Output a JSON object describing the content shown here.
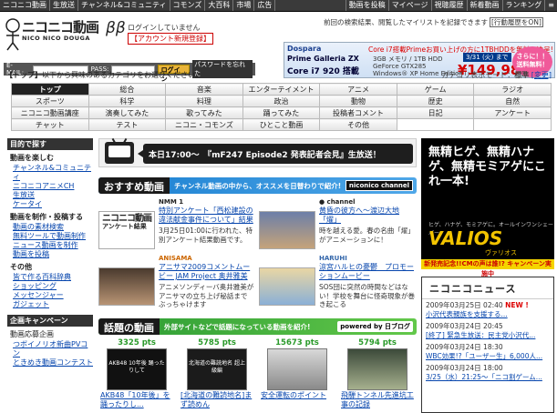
{
  "topnav": {
    "left": [
      "ニコニコ動画",
      "生放送",
      "チャンネル&コミュニティ",
      "コモンズ",
      "大百科",
      "市場",
      "広告"
    ],
    "right": [
      "動画を投稿",
      "マイページ",
      "視聴履歴",
      "新着動画",
      "ランキング",
      "≡"
    ]
  },
  "header": {
    "logo_text": "ニコニコ動画",
    "logo_sub": "NICO NICO DOUGA",
    "logo_version": "ββ",
    "login_message": "ログインしていません",
    "signup_link": "【アカウント新規登録】",
    "notice": "前回の検索結果、閲覧したマイリストを記録できます",
    "notice_link": "[行動履歴をON]"
  },
  "login": {
    "email_label": "E-MAIL:",
    "pass_label": "PASS:",
    "login_button": "ログイン",
    "forgot_button": "パスワードを忘れた"
  },
  "banner": {
    "brand": "Dospara",
    "headline": "Core i7搭載Primeお買い上げの方に1TBHDDを無料で進呈!",
    "product": "Prime Galleria ZX",
    "cpu": "Core i7 920 搭載",
    "spec1": "3GB メモリ / 1TB HDD",
    "spec2": "GeForce GTX285",
    "spec3": "Windows® XP Home Edition",
    "date": "3/31 (火) まで",
    "price": "¥149,980",
    "badge": "さらに！！ 送料無料！"
  },
  "category": {
    "breadcrumb": "【トップ】",
    "instruction": "以下から興味のあるカテゴリをお選びください。",
    "mode_label": "カテゴリ表示モード：",
    "mode_value": "標準",
    "mode_change": "[変更]",
    "rows": [
      [
        "トップ",
        "総合",
        "音楽",
        "エンターテイメント",
        "アニメ",
        "ゲーム",
        "ラジオ"
      ],
      [
        "スポーツ",
        "科学",
        "料理",
        "政治",
        "動物",
        "歴史",
        "自然"
      ],
      [
        "ニコニコ動画講座",
        "演奏してみた",
        "歌ってみた",
        "踊ってみた",
        "投稿者コメント",
        "日記",
        "アンケート"
      ],
      [
        "チャット",
        "テスト",
        "ニコニ・コモンズ",
        "ひとこと動画",
        "その他",
        "",
        ""
      ]
    ]
  },
  "sidebar": {
    "head": "目的で探す",
    "sections": [
      {
        "title": "動画を楽しむ",
        "items": [
          "チャンネル&コミュニティ",
          "ニコニコアニメCH",
          "生放送",
          "ケータイ"
        ]
      },
      {
        "title": "動画を制作・投稿する",
        "items": [
          "動画の素材検索",
          "無料ツールで動画制作",
          "ニュース動画を制作",
          "動画を投稿"
        ]
      },
      {
        "title": "その他",
        "items": [
          "皆で作る百科辞典",
          "ショッピング",
          "メッセンジャー",
          "ガジェット"
        ]
      }
    ],
    "campaign_head": "企画キャンペーン",
    "campaign_items": [
      "動画応募企画",
      "つボイノリオ新曲PVコン",
      "ときめき動画コンテスト"
    ]
  },
  "main": {
    "live_notice": "本日17:00～　『mF247 Episode2 発表記者会見』生放送！",
    "recommend": {
      "title": "おすすめ動画",
      "subtitle": "チャンネル動画の中から、オススメを日替わりで紹介!",
      "tag": "niconico channel",
      "articles": [
        {
          "source": "NMM 1",
          "title": "特別アンケート「西松建設の違法献金事件について」結果",
          "desc": "3月25日01:00に行われた、特別アンケート結果動画です。",
          "thumb_text": "アンケート結果"
        },
        {
          "source": "● channel",
          "title": "黄昏の彼方へ～渡辺大地「燿」",
          "desc": "時を越える愛。春の名曲「燿」がアニメーションに！",
          "thumb_text": ""
        },
        {
          "source": "ANISAMA",
          "title": "アニサマ2009コメントムービー JAM Project 奥井雅美",
          "desc": "アニメソンディーバ奥井雅美がアニサマの立ち上げ秘話まで　ぶっちゃけます",
          "thumb_text": ""
        },
        {
          "source": "HARUHI",
          "title": "涼宮ハルヒの憂鬱　プロモーションムービー",
          "desc": "SOS団に突然の時間などはない！学校を舞台に怪奇現象が巻き起こる",
          "thumb_text": ""
        }
      ]
    },
    "topic": {
      "title": "話題の動画",
      "subtitle": "外部サイトなどで話題になっている動画を紹介!",
      "powered": "powered by 日ブログ"
    },
    "videos": [
      {
        "count": "3325 pts",
        "title": "AKB48「10年後」を踊ったりし...",
        "thumb_text": "AKB48 10年後 踊ったりして"
      },
      {
        "count": "5785 pts",
        "title": "[北海道の難読地名]まず読めん",
        "thumb_text": "北海道の難読地名 超上級編"
      },
      {
        "count": "15673 pts",
        "title": "安全運転のポイント",
        "thumb_text": ""
      },
      {
        "count": "5794 pts",
        "title": "飛騨トンネル先進坑工事の記録",
        "thumb_text": ""
      }
    ]
  },
  "right": {
    "ad_text": "無精ヒゲ、無精ハナゲ、無精モミアゲにこれ一本!",
    "ad_small": "ヒゲ、ハナゲ、モミアゲに。オールインワンシェーバー",
    "ad_product": "VALIOS",
    "ad_product_sub": "ヴァリオス",
    "ad_bar": "新発売記念!!CMの声は誰!? キャンペーン実施中",
    "news_head": "ニコニコニュース",
    "news": [
      {
        "date": "2009年03月25日 02:40",
        "new": "NEW !",
        "title": "小沢代表親族を支援する..."
      },
      {
        "date": "2009年03月24日 20:45",
        "new": "",
        "title": "[終了] 緊急生放送：民主党小沢代..."
      },
      {
        "date": "2009年03月24日 18:30",
        "new": "",
        "title": "WBC効果!?「ユーザー生」6,000人..."
      },
      {
        "date": "2009年03月24日 18:00",
        "new": "",
        "title": "3/25（水）21:25～「ニコ割ゲーム..."
      }
    ]
  }
}
